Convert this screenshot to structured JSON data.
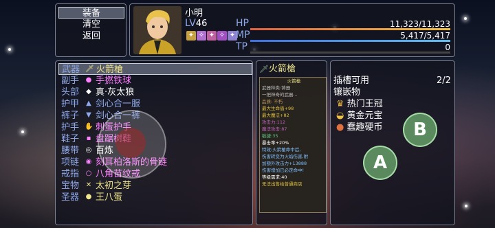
{
  "commands": [
    "装备",
    "清空",
    "返回"
  ],
  "actor": {
    "name": "小明",
    "level_label": "LV",
    "level": "46",
    "hp_label": "HP",
    "hp_value": "11,323/11,323",
    "mp_label": "MP",
    "mp_value": "5,417/5,417",
    "tp_label": "TP",
    "tp_value": "0",
    "state_icons": [
      "✦",
      "✧",
      "✦",
      "✧",
      "✦"
    ]
  },
  "equip_slots": [
    {
      "slot": "武器",
      "item": "火箭槍",
      "color": "#f0e68c",
      "icon": "🗡"
    },
    {
      "slot": "副手",
      "item": "手撚铁球",
      "color": "#ff80ff",
      "icon": "●"
    },
    {
      "slot": "头部",
      "item": "真·灰太狼",
      "color": "#ffffff",
      "icon": "◆"
    },
    {
      "slot": "护甲",
      "item": "剑心合一服",
      "color": "#8fa8e8",
      "icon": "▲"
    },
    {
      "slot": "裤子",
      "item": "剑心合一裤",
      "color": "#8fa8e8",
      "icon": "▼"
    },
    {
      "slot": "护手",
      "item": "刺蛋护手",
      "color": "#ff80ff",
      "icon": "✋"
    },
    {
      "slot": "鞋子",
      "item": "盘踞树鞋",
      "color": "#ff80ff",
      "icon": "▪"
    },
    {
      "slot": "腰带",
      "item": "百炼",
      "color": "#ffffff",
      "icon": "◎"
    },
    {
      "slot": "项链",
      "item": "刻耳柏洛斯的骨链",
      "color": "#ff80ff",
      "icon": "◉"
    },
    {
      "slot": "戒指",
      "item": "八角苗纹戒",
      "color": "#ff80ff",
      "icon": "○"
    },
    {
      "slot": "宝物",
      "item": "太初之芽",
      "color": "#f0e68c",
      "icon": "✕"
    },
    {
      "slot": "圣器",
      "item": "王八蛋",
      "color": "#f0e68c",
      "icon": "●"
    }
  ],
  "detail": {
    "title": "火箭槍",
    "tooltip": [
      "火箭槍",
      "武器种类:铸器",
      "一把神奇的武器...",
      "",
      "品质: 不朽",
      "最大生命值+98",
      "最大魔法+82",
      "攻击力:112",
      "魔法攻击:87",
      "",
      "敏捷:35",
      "",
      "暴击率+20%",
      "特效:火箭槍命中后,",
      "伤害转变为火焰伤害,附",
      "加额外攻击力+13888",
      "伤害增加已必定命中!",
      "等级需求:40",
      "无法出售给普通商店"
    ]
  },
  "right_list": {
    "header": "插槽可用",
    "count": "2/2",
    "subheader": "镶嵌物",
    "items": [
      "热门王冠",
      "黄金元宝",
      "蠢趣硬币"
    ]
  },
  "buttons": {
    "a": "A",
    "b": "B"
  }
}
